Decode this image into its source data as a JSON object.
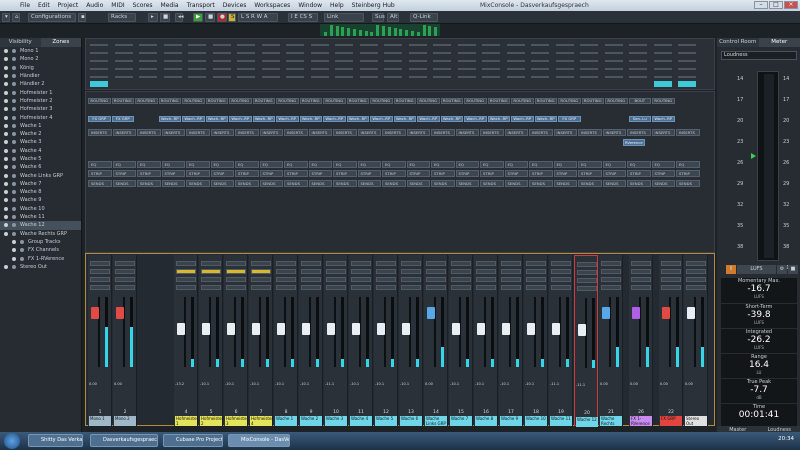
{
  "titlebar": {
    "menus": [
      "File",
      "Edit",
      "Project",
      "Audio",
      "MIDI",
      "Scores",
      "Media",
      "Transport",
      "Devices",
      "Workspaces",
      "Window",
      "Help",
      "Steinberg Hub"
    ],
    "title": "MixConsole - Dasverkaufsgespraech"
  },
  "toolbar": {
    "configurations": "Configurations",
    "racks": "Racks",
    "link": "Link",
    "sus": "Sus",
    "alt": "Alt",
    "qlink": "Q-Link"
  },
  "left_panel": {
    "tabs": [
      "Visibility",
      "Zones"
    ],
    "channels": [
      "Mono 1",
      "Mono 2",
      "König",
      "Händler",
      "Händler 2",
      "Hofmeister 1",
      "Hofmeister 2",
      "Hofmeister 3",
      "Hofmeister 4",
      "Wache 1",
      "Wache 2",
      "Wache 3",
      "Wache 4",
      "Wache 5",
      "Wache 6",
      "Wache Links GRP",
      "Wache 7",
      "Wache 8",
      "Wache 9",
      "Wache 10",
      "Wache 11",
      "Wache 12",
      "Wache Rechts GRP",
      "Group Tracks",
      "FX Channels",
      "FX 1-RVerence",
      "Stereo Out"
    ]
  },
  "racks": {
    "routing": "ROUTING",
    "inserts": "INSERTS",
    "eq": "EQ",
    "strip": "STRIP",
    "sends": "SENDS",
    "fx_grp": "FX GRP",
    "wache_rgp": "Wach..RP",
    "stereo_out": "Stereo Out",
    "bout": "BOUT",
    "reverb": "RVerence",
    "send_lu": "Sen..Lu"
  },
  "mixer": {
    "strips": [
      {
        "num": "1",
        "name": "Mono 1",
        "val": "0.00",
        "c": "#9fb8c8"
      },
      {
        "num": "2",
        "name": "Mono 2",
        "val": "0.00",
        "c": "#9fb8c8"
      },
      {
        "num": "4",
        "name": "Hofmeister 1",
        "val": "-13.2",
        "c": "#e4e35a"
      },
      {
        "num": "5",
        "name": "Hofmeister 2",
        "val": "-10.1",
        "c": "#e4e35a"
      },
      {
        "num": "6",
        "name": "Hofmeister 3",
        "val": "-10.1",
        "c": "#e4e35a"
      },
      {
        "num": "7",
        "name": "Hofmeister 4",
        "val": "-10.1",
        "c": "#e4e35a"
      },
      {
        "num": "8",
        "name": "Wache 1",
        "val": "-10.1",
        "c": "#6fd5e8"
      },
      {
        "num": "9",
        "name": "Wache 2",
        "val": "-10.1",
        "c": "#6fd5e8"
      },
      {
        "num": "10",
        "name": "Wache 3",
        "val": "-11.1",
        "c": "#6fd5e8"
      },
      {
        "num": "11",
        "name": "Wache 4",
        "val": "-10.1",
        "c": "#6fd5e8"
      },
      {
        "num": "12",
        "name": "Wache 5",
        "val": "-10.1",
        "c": "#6fd5e8"
      },
      {
        "num": "13",
        "name": "Wache 6",
        "val": "-10.1",
        "c": "#6fd5e8"
      },
      {
        "num": "14",
        "name": "Wache Links GRP",
        "val": "0.00",
        "c": "#6fd5e8"
      },
      {
        "num": "15",
        "name": "Wache 7",
        "val": "-10.1",
        "c": "#6fd5e8"
      },
      {
        "num": "16",
        "name": "Wache 8",
        "val": "-10.1",
        "c": "#6fd5e8"
      },
      {
        "num": "17",
        "name": "Wache 9",
        "val": "-10.1",
        "c": "#6fd5e8"
      },
      {
        "num": "18",
        "name": "Wache 10",
        "val": "-10.1",
        "c": "#6fd5e8"
      },
      {
        "num": "19",
        "name": "Wache 11",
        "val": "-11.1",
        "c": "#6fd5e8"
      },
      {
        "num": "20",
        "name": "Wache 12",
        "val": "-11.1",
        "c": "#6fd5e8"
      },
      {
        "num": "21",
        "name": "Wache Rechts",
        "val": "0.00",
        "c": "#6fd5e8"
      },
      {
        "num": "26",
        "name": "FX 1-RVerence",
        "val": "0.00",
        "c": "#c98bf0"
      },
      {
        "num": "22",
        "name": "FX GRP",
        "val": "0.00",
        "c": "#e2453f"
      },
      {
        "num": "",
        "name": "Stereo Out",
        "val": "0.00",
        "c": "#e0e0e0"
      }
    ]
  },
  "right_panel": {
    "tabs": [
      "Control Room",
      "Meter"
    ],
    "select": "Loudness",
    "scale": [
      "14",
      "17",
      "20",
      "23",
      "26",
      "29",
      "32",
      "35",
      "38",
      "41"
    ],
    "lufs_btn": "LUFS",
    "momentary_max": {
      "label": "Momentary Max.",
      "value": "-16.7",
      "unit": "LUFS"
    },
    "short_term": {
      "label": "Short-Term",
      "value": "-39.8",
      "unit": "LUFS"
    },
    "integrated": {
      "label": "Integrated",
      "value": "-26.2",
      "unit": "LUFS"
    },
    "range": {
      "label": "Range",
      "value": "16.4",
      "unit": "LU"
    },
    "true_peak": {
      "label": "True Peak",
      "value": "-7.7",
      "unit": "dB"
    },
    "time": {
      "label": "Time",
      "value": "00:01:41"
    },
    "bottom_tabs": [
      "Master",
      "Loudness"
    ]
  },
  "taskbar": {
    "tasks": [
      "Shitty Das Verkaufsg...",
      "Dasverkaufsgespraech",
      "Cubase Pro Project b...",
      "MixConsole - DasVer..."
    ],
    "clock": "20:34"
  }
}
